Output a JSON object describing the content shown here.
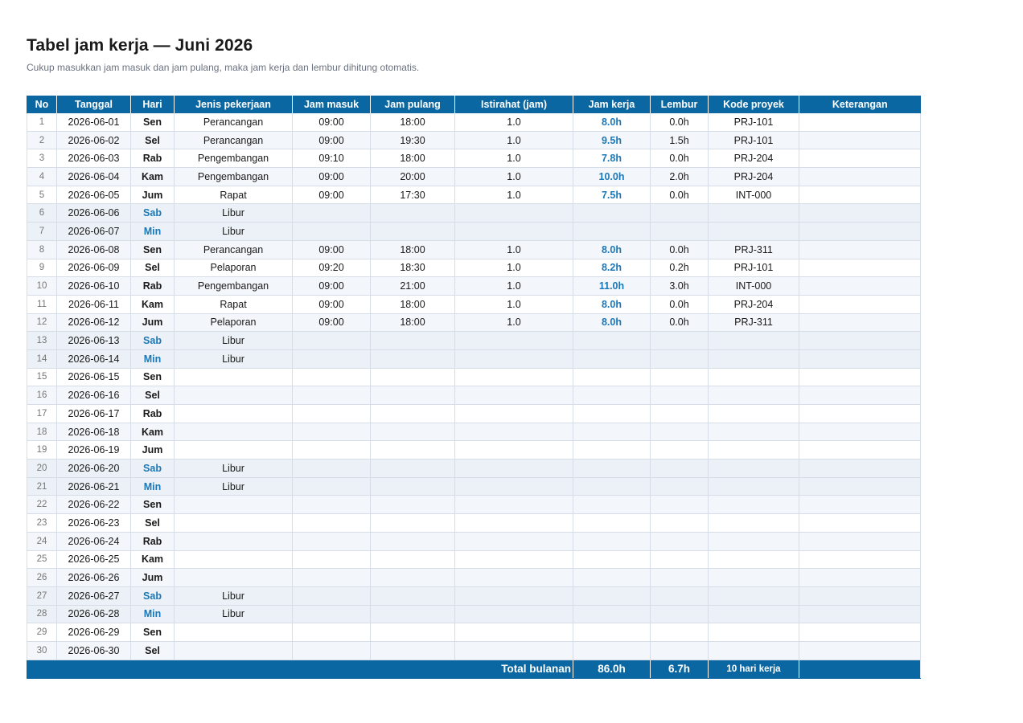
{
  "header": {
    "title": "Tabel jam kerja — Juni 2026",
    "subtitle": "Cukup masukkan jam masuk dan jam pulang, maka jam kerja dan lembur dihitung otomatis."
  },
  "columns": [
    "No",
    "Tanggal",
    "Hari",
    "Jenis pekerjaan",
    "Jam masuk",
    "Jam pulang",
    "Istirahat (jam)",
    "Jam kerja",
    "Lembur",
    "Kode proyek",
    "Keterangan"
  ],
  "rows": [
    {
      "no": "1",
      "date": "2026-06-01",
      "day": "Sen",
      "weekend": false,
      "type": "Perancangan",
      "in": "09:00",
      "out": "18:00",
      "break": "1.0",
      "work": "8.0h",
      "overtime": "0.0h",
      "project": "PRJ-101",
      "note": ""
    },
    {
      "no": "2",
      "date": "2026-06-02",
      "day": "Sel",
      "weekend": false,
      "type": "Perancangan",
      "in": "09:00",
      "out": "19:30",
      "break": "1.0",
      "work": "9.5h",
      "overtime": "1.5h",
      "project": "PRJ-101",
      "note": ""
    },
    {
      "no": "3",
      "date": "2026-06-03",
      "day": "Rab",
      "weekend": false,
      "type": "Pengembangan",
      "in": "09:10",
      "out": "18:00",
      "break": "1.0",
      "work": "7.8h",
      "overtime": "0.0h",
      "project": "PRJ-204",
      "note": ""
    },
    {
      "no": "4",
      "date": "2026-06-04",
      "day": "Kam",
      "weekend": false,
      "type": "Pengembangan",
      "in": "09:00",
      "out": "20:00",
      "break": "1.0",
      "work": "10.0h",
      "overtime": "2.0h",
      "project": "PRJ-204",
      "note": ""
    },
    {
      "no": "5",
      "date": "2026-06-05",
      "day": "Jum",
      "weekend": false,
      "type": "Rapat",
      "in": "09:00",
      "out": "17:30",
      "break": "1.0",
      "work": "7.5h",
      "overtime": "0.0h",
      "project": "INT-000",
      "note": ""
    },
    {
      "no": "6",
      "date": "2026-06-06",
      "day": "Sab",
      "weekend": true,
      "type": "Libur",
      "in": "",
      "out": "",
      "break": "",
      "work": "",
      "overtime": "",
      "project": "",
      "note": ""
    },
    {
      "no": "7",
      "date": "2026-06-07",
      "day": "Min",
      "weekend": true,
      "type": "Libur",
      "in": "",
      "out": "",
      "break": "",
      "work": "",
      "overtime": "",
      "project": "",
      "note": ""
    },
    {
      "no": "8",
      "date": "2026-06-08",
      "day": "Sen",
      "weekend": false,
      "type": "Perancangan",
      "in": "09:00",
      "out": "18:00",
      "break": "1.0",
      "work": "8.0h",
      "overtime": "0.0h",
      "project": "PRJ-311",
      "note": ""
    },
    {
      "no": "9",
      "date": "2026-06-09",
      "day": "Sel",
      "weekend": false,
      "type": "Pelaporan",
      "in": "09:20",
      "out": "18:30",
      "break": "1.0",
      "work": "8.2h",
      "overtime": "0.2h",
      "project": "PRJ-101",
      "note": ""
    },
    {
      "no": "10",
      "date": "2026-06-10",
      "day": "Rab",
      "weekend": false,
      "type": "Pengembangan",
      "in": "09:00",
      "out": "21:00",
      "break": "1.0",
      "work": "11.0h",
      "overtime": "3.0h",
      "project": "INT-000",
      "note": ""
    },
    {
      "no": "11",
      "date": "2026-06-11",
      "day": "Kam",
      "weekend": false,
      "type": "Rapat",
      "in": "09:00",
      "out": "18:00",
      "break": "1.0",
      "work": "8.0h",
      "overtime": "0.0h",
      "project": "PRJ-204",
      "note": ""
    },
    {
      "no": "12",
      "date": "2026-06-12",
      "day": "Jum",
      "weekend": false,
      "type": "Pelaporan",
      "in": "09:00",
      "out": "18:00",
      "break": "1.0",
      "work": "8.0h",
      "overtime": "0.0h",
      "project": "PRJ-311",
      "note": ""
    },
    {
      "no": "13",
      "date": "2026-06-13",
      "day": "Sab",
      "weekend": true,
      "type": "Libur",
      "in": "",
      "out": "",
      "break": "",
      "work": "",
      "overtime": "",
      "project": "",
      "note": ""
    },
    {
      "no": "14",
      "date": "2026-06-14",
      "day": "Min",
      "weekend": true,
      "type": "Libur",
      "in": "",
      "out": "",
      "break": "",
      "work": "",
      "overtime": "",
      "project": "",
      "note": ""
    },
    {
      "no": "15",
      "date": "2026-06-15",
      "day": "Sen",
      "weekend": false,
      "type": "",
      "in": "",
      "out": "",
      "break": "",
      "work": "",
      "overtime": "",
      "project": "",
      "note": ""
    },
    {
      "no": "16",
      "date": "2026-06-16",
      "day": "Sel",
      "weekend": false,
      "type": "",
      "in": "",
      "out": "",
      "break": "",
      "work": "",
      "overtime": "",
      "project": "",
      "note": ""
    },
    {
      "no": "17",
      "date": "2026-06-17",
      "day": "Rab",
      "weekend": false,
      "type": "",
      "in": "",
      "out": "",
      "break": "",
      "work": "",
      "overtime": "",
      "project": "",
      "note": ""
    },
    {
      "no": "18",
      "date": "2026-06-18",
      "day": "Kam",
      "weekend": false,
      "type": "",
      "in": "",
      "out": "",
      "break": "",
      "work": "",
      "overtime": "",
      "project": "",
      "note": ""
    },
    {
      "no": "19",
      "date": "2026-06-19",
      "day": "Jum",
      "weekend": false,
      "type": "",
      "in": "",
      "out": "",
      "break": "",
      "work": "",
      "overtime": "",
      "project": "",
      "note": ""
    },
    {
      "no": "20",
      "date": "2026-06-20",
      "day": "Sab",
      "weekend": true,
      "type": "Libur",
      "in": "",
      "out": "",
      "break": "",
      "work": "",
      "overtime": "",
      "project": "",
      "note": ""
    },
    {
      "no": "21",
      "date": "2026-06-21",
      "day": "Min",
      "weekend": true,
      "type": "Libur",
      "in": "",
      "out": "",
      "break": "",
      "work": "",
      "overtime": "",
      "project": "",
      "note": ""
    },
    {
      "no": "22",
      "date": "2026-06-22",
      "day": "Sen",
      "weekend": false,
      "type": "",
      "in": "",
      "out": "",
      "break": "",
      "work": "",
      "overtime": "",
      "project": "",
      "note": ""
    },
    {
      "no": "23",
      "date": "2026-06-23",
      "day": "Sel",
      "weekend": false,
      "type": "",
      "in": "",
      "out": "",
      "break": "",
      "work": "",
      "overtime": "",
      "project": "",
      "note": ""
    },
    {
      "no": "24",
      "date": "2026-06-24",
      "day": "Rab",
      "weekend": false,
      "type": "",
      "in": "",
      "out": "",
      "break": "",
      "work": "",
      "overtime": "",
      "project": "",
      "note": ""
    },
    {
      "no": "25",
      "date": "2026-06-25",
      "day": "Kam",
      "weekend": false,
      "type": "",
      "in": "",
      "out": "",
      "break": "",
      "work": "",
      "overtime": "",
      "project": "",
      "note": ""
    },
    {
      "no": "26",
      "date": "2026-06-26",
      "day": "Jum",
      "weekend": false,
      "type": "",
      "in": "",
      "out": "",
      "break": "",
      "work": "",
      "overtime": "",
      "project": "",
      "note": ""
    },
    {
      "no": "27",
      "date": "2026-06-27",
      "day": "Sab",
      "weekend": true,
      "type": "Libur",
      "in": "",
      "out": "",
      "break": "",
      "work": "",
      "overtime": "",
      "project": "",
      "note": ""
    },
    {
      "no": "28",
      "date": "2026-06-28",
      "day": "Min",
      "weekend": true,
      "type": "Libur",
      "in": "",
      "out": "",
      "break": "",
      "work": "",
      "overtime": "",
      "project": "",
      "note": ""
    },
    {
      "no": "29",
      "date": "2026-06-29",
      "day": "Sen",
      "weekend": false,
      "type": "",
      "in": "",
      "out": "",
      "break": "",
      "work": "",
      "overtime": "",
      "project": "",
      "note": ""
    },
    {
      "no": "30",
      "date": "2026-06-30",
      "day": "Sel",
      "weekend": false,
      "type": "",
      "in": "",
      "out": "",
      "break": "",
      "work": "",
      "overtime": "",
      "project": "",
      "note": ""
    }
  ],
  "footer": {
    "label": "Total bulanan",
    "total_work": "86.0h",
    "total_overtime": "6.7h",
    "days_worked": "10 hari kerja"
  },
  "colors": {
    "header_bg": "#0b67a1",
    "accent_text": "#1b78b8",
    "weekend_row": "#ebf1f6",
    "stripe_row": "#f3f7fb"
  }
}
